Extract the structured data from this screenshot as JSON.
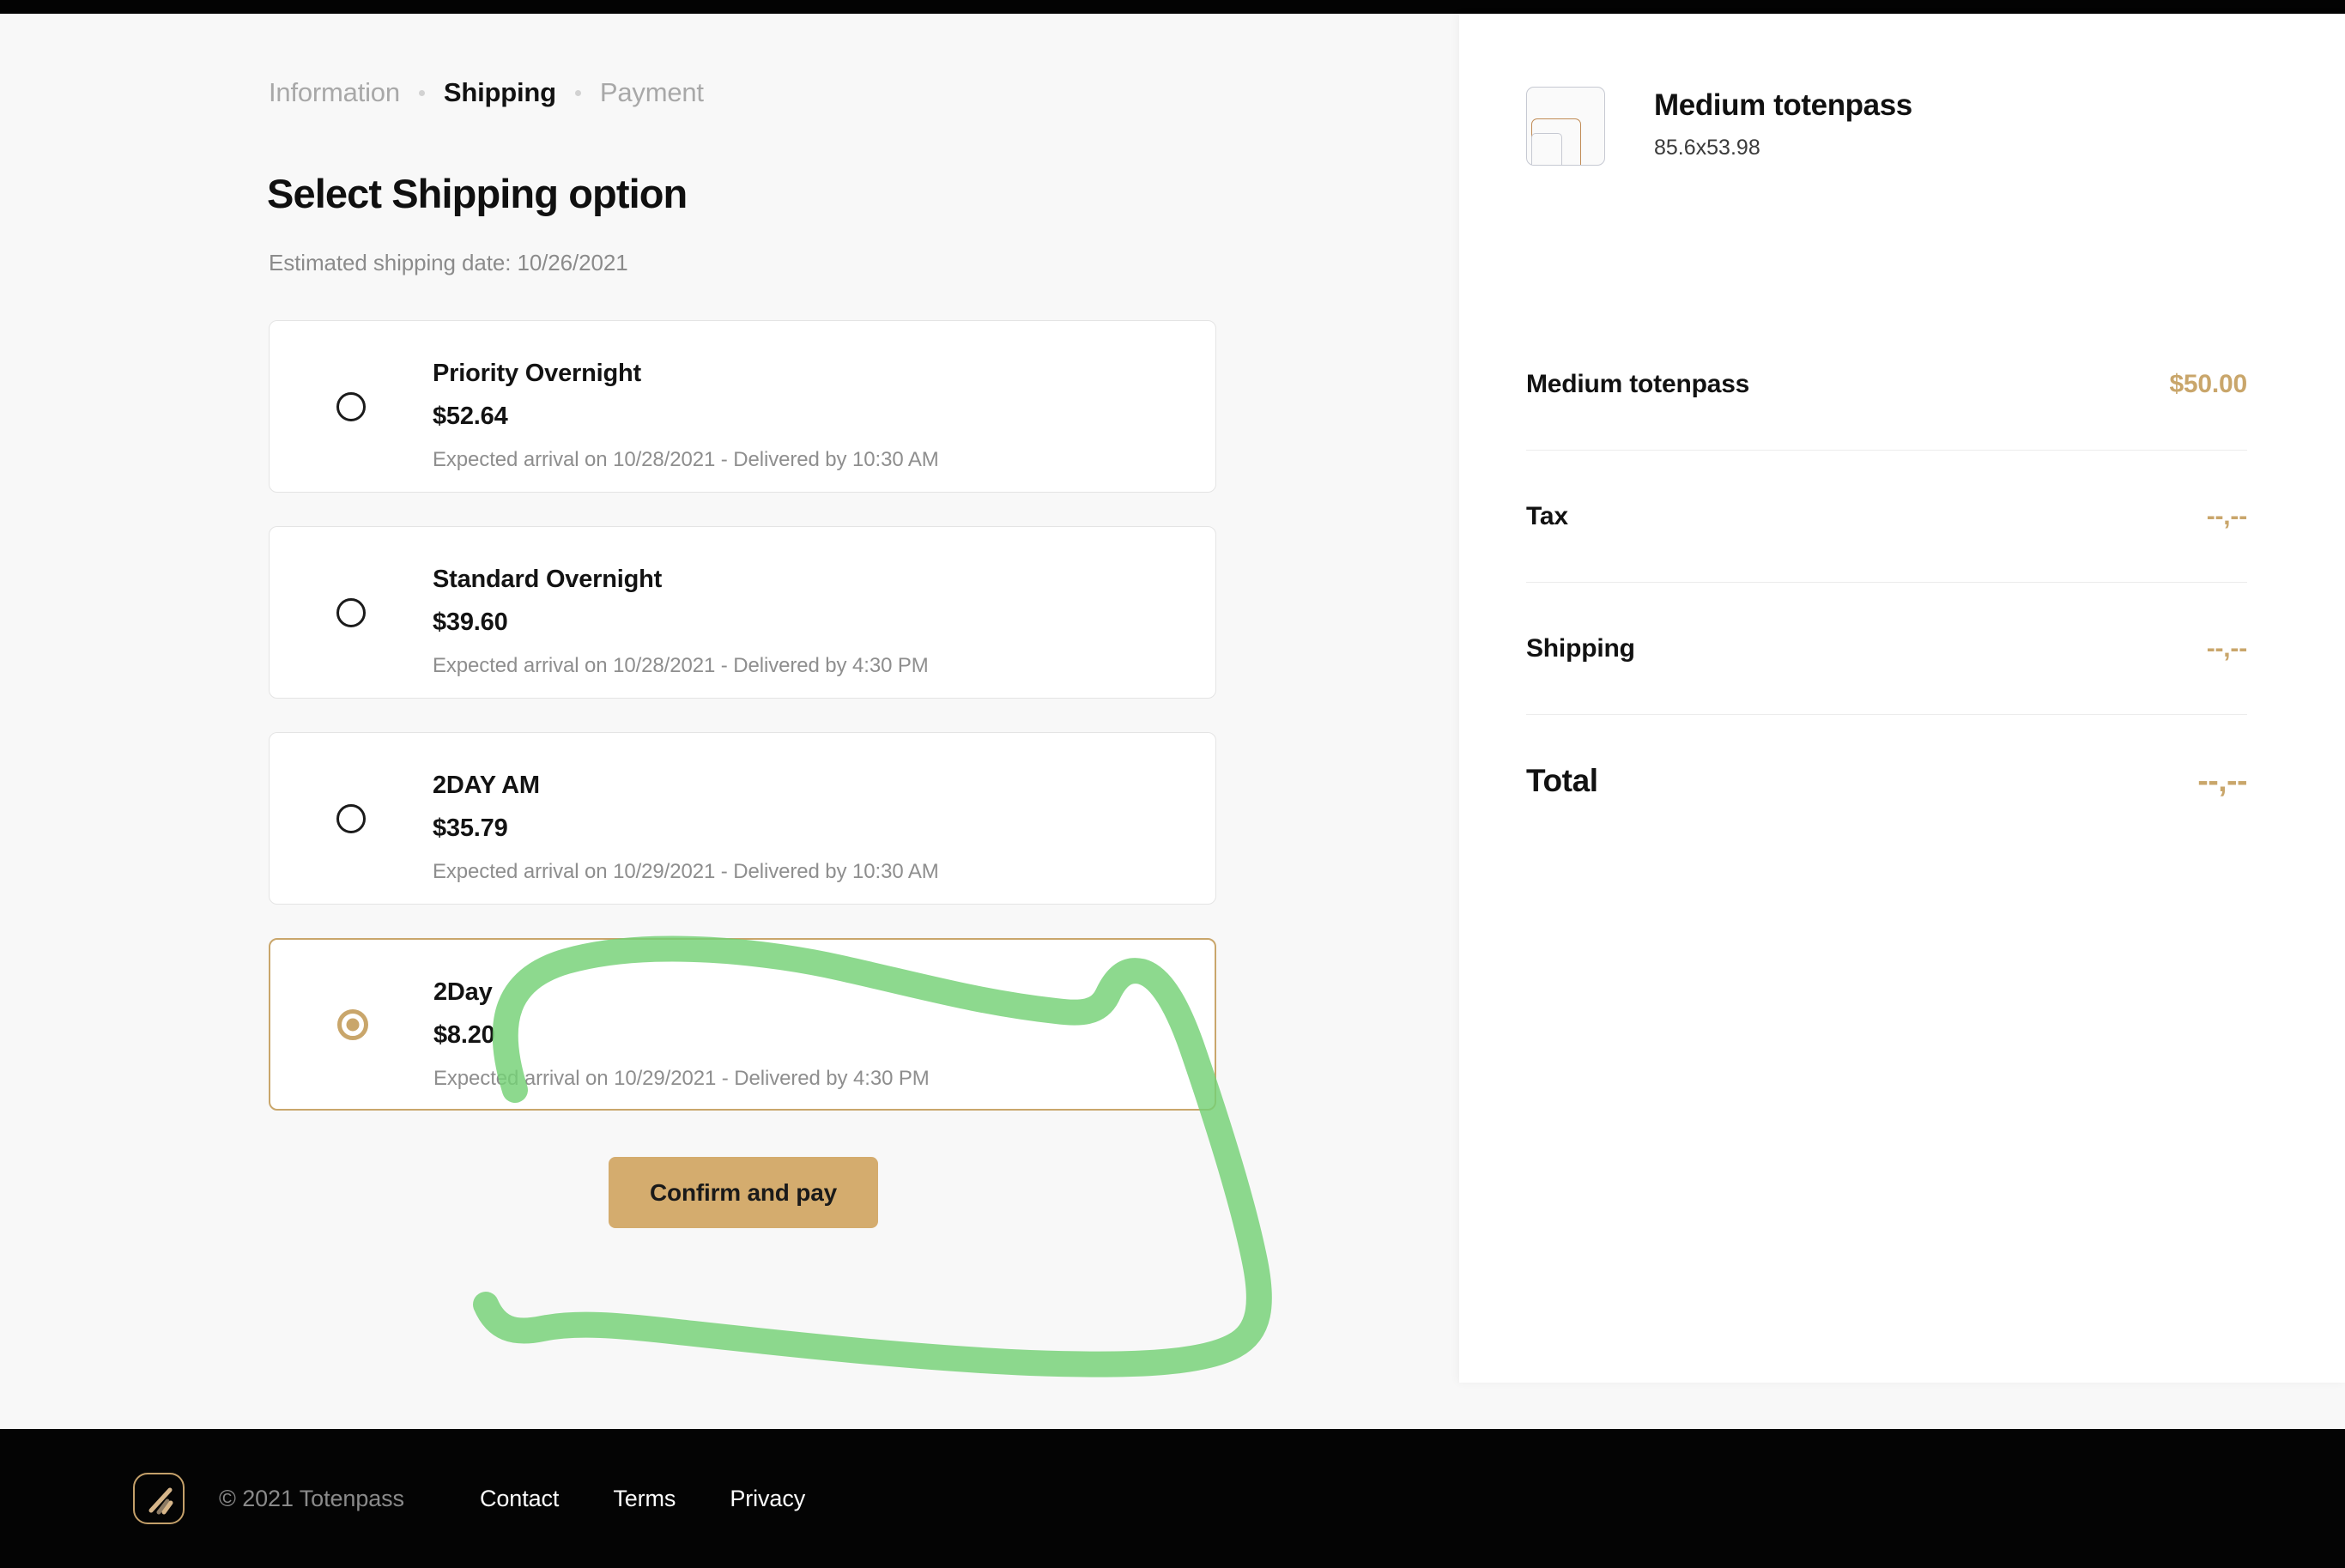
{
  "breadcrumb": {
    "steps": [
      {
        "label": "Information",
        "active": false
      },
      {
        "label": "Shipping",
        "active": true
      },
      {
        "label": "Payment",
        "active": false
      }
    ]
  },
  "main": {
    "title": "Select Shipping option",
    "estimated_shipping": "Estimated shipping date: 10/26/2021",
    "confirm_label": "Confirm and pay",
    "shipping_options": [
      {
        "name": "Priority Overnight",
        "price": "$52.64",
        "eta": "Expected arrival on 10/28/2021 - Delivered by 10:30 AM",
        "selected": false
      },
      {
        "name": "Standard Overnight",
        "price": "$39.60",
        "eta": "Expected arrival on 10/28/2021 - Delivered by 4:30 PM",
        "selected": false
      },
      {
        "name": "2DAY AM",
        "price": "$35.79",
        "eta": "Expected arrival on 10/29/2021 - Delivered by 10:30 AM",
        "selected": false
      },
      {
        "name": "2Day",
        "price": "$8.20",
        "eta": "Expected arrival on 10/29/2021 - Delivered by 4:30 PM",
        "selected": true
      }
    ]
  },
  "summary": {
    "product": {
      "name": "Medium totenpass",
      "dimensions": "85.6x53.98",
      "thumbnail_icon": "totenpass-card-icon"
    },
    "rows": [
      {
        "label": "Medium totenpass",
        "value": "$50.00",
        "emphasis": false
      },
      {
        "label": "Tax",
        "value": "--,--",
        "emphasis": false
      },
      {
        "label": "Shipping",
        "value": "--,--",
        "emphasis": false
      },
      {
        "label": "Total",
        "value": "--,--",
        "emphasis": true
      }
    ]
  },
  "footer": {
    "logo_icon": "totenpass-logo-icon",
    "copyright": "© 2021 Totenpass",
    "links": [
      "Contact",
      "Terms",
      "Privacy"
    ]
  },
  "annotation": {
    "type": "freehand-lasso",
    "color": "#74d175",
    "target": "confirm-and-pay-button"
  },
  "colors": {
    "accent_tan": "#c9a66b",
    "button_tan": "#d4ac6e",
    "annotation_green": "#74d175",
    "page_bg": "#f8f8f8",
    "panel_bg": "#ffffff",
    "bar_black": "#040404"
  }
}
